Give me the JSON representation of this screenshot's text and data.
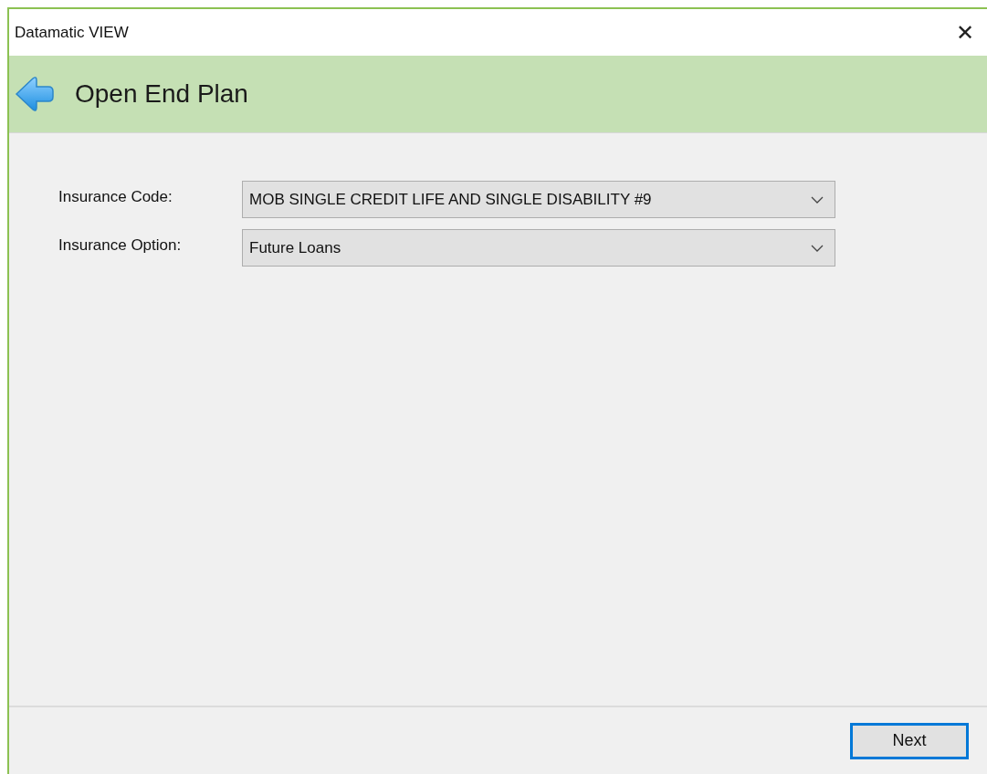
{
  "window": {
    "title": "Datamatic VIEW",
    "close": "✕"
  },
  "header": {
    "title": "Open End Plan"
  },
  "fields": [
    {
      "label": "Insurance Code:",
      "value": "MOB SINGLE CREDIT LIFE AND SINGLE DISABILITY #9"
    },
    {
      "label": "Insurance Option:",
      "value": "Future Loans"
    }
  ],
  "buttons": [
    {
      "label": "Next",
      "focused": true
    }
  ]
}
